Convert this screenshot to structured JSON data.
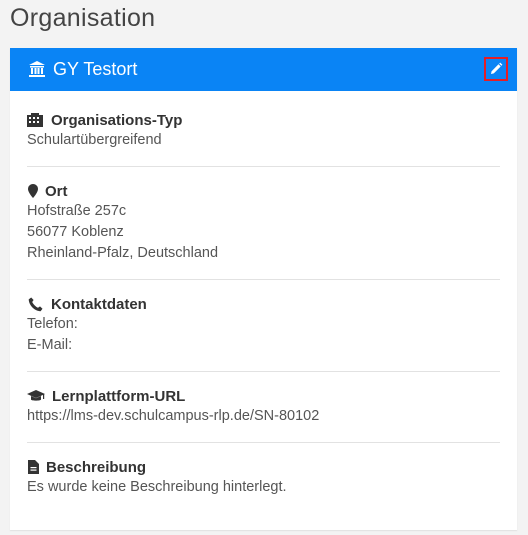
{
  "page": {
    "title": "Organisation"
  },
  "card": {
    "header_title": "GY Testort",
    "header_color": "#0a84f5",
    "header_icon": "institution-icon",
    "edit_icon": "pencil-icon",
    "edit_highlight_color": "#e41e26"
  },
  "sections": {
    "type": {
      "icon": "building-icon",
      "title": "Organisations-Typ",
      "value": "Schulartübergreifend"
    },
    "location": {
      "icon": "map-marker-icon",
      "title": "Ort",
      "street": "Hofstraße 257c",
      "city": "56077 Koblenz",
      "region": "Rheinland-Pfalz, Deutschland"
    },
    "contact": {
      "icon": "phone-icon",
      "title": "Kontaktdaten",
      "phone_label": "Telefon:",
      "email_label": "E-Mail:"
    },
    "lms": {
      "icon": "graduation-cap-icon",
      "title": "Lernplattform-URL",
      "url": "https://lms-dev.schulcampus-rlp.de/SN-80102"
    },
    "description": {
      "icon": "document-icon",
      "title": "Beschreibung",
      "value": "Es wurde keine Beschreibung hinterlegt."
    }
  }
}
